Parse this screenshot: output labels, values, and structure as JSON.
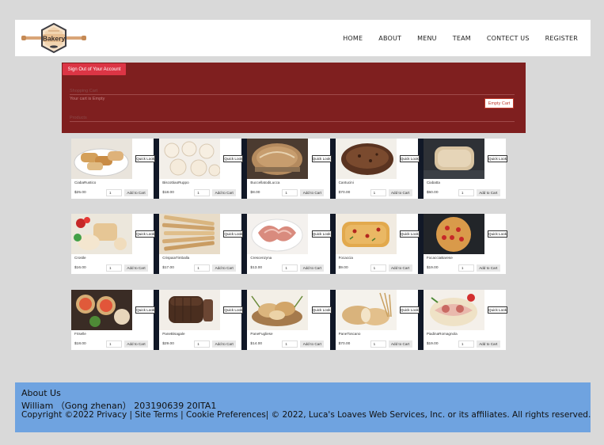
{
  "header": {
    "logo": {
      "text": "Bakery",
      "icon": "bakery-logo-rolling-pin"
    },
    "nav": [
      {
        "label": "HOME"
      },
      {
        "label": "ABOUT"
      },
      {
        "label": "MENU"
      },
      {
        "label": "TEAM"
      },
      {
        "label": "CONTECT US"
      },
      {
        "label": "REGISTER"
      }
    ]
  },
  "cart": {
    "signout_label": "Sign Out of Your Account",
    "title": "Shopping Cart",
    "empty_text": "Your cart is Empty",
    "empty_button": "Empty Cart",
    "products_label": "Products"
  },
  "products": [
    [
      {
        "name": "CiabaRustico",
        "price": "$25.00",
        "qty": "1",
        "quick_look": "Quick Look",
        "add_label": "Add to Cart",
        "image": "bread-loaves-cut"
      },
      {
        "name": "BiscottiaoRuppo",
        "price": "$18.00",
        "qty": "1",
        "quick_look": "Quick Look",
        "add_label": "Add to Cart",
        "image": "white-knot-buns"
      },
      {
        "name": "BuccellatodiLucca",
        "price": "$8.00",
        "qty": "1",
        "quick_look": "Quick Look",
        "add_label": "Add to Cart",
        "image": "round-rustic-loaf"
      },
      {
        "name": "Cantucini",
        "price": "$70.00",
        "qty": "1",
        "quick_look": "Quick Look",
        "add_label": "Add to Cart",
        "image": "dark-sliced-loaf"
      },
      {
        "name": "Ciabatta",
        "price": "$50.00",
        "qty": "1",
        "quick_look": "Quick Look",
        "add_label": "Add to Cart",
        "image": "ciabatta-on-slate"
      }
    ],
    [
      {
        "name": "Crostle",
        "price": "$16.00",
        "qty": "1",
        "quick_look": "Quick Look",
        "add_label": "Add to Cart",
        "image": "crostini-tomatoes"
      },
      {
        "name": "CrispaiaTimballa",
        "price": "$17.00",
        "qty": "1",
        "quick_look": "Quick Look",
        "add_label": "Add to Cart",
        "image": "breadsticks"
      },
      {
        "name": "Crescenzyna",
        "price": "$13.00",
        "qty": "1",
        "quick_look": "Quick Look",
        "add_label": "Add to Cart",
        "image": "ham-slices-plate"
      },
      {
        "name": "Focaccia",
        "price": "$9.00",
        "qty": "1",
        "quick_look": "Quick Look",
        "add_label": "Add to Cart",
        "image": "focaccia-herbs"
      },
      {
        "name": "FocacciaBarese",
        "price": "$19.00",
        "qty": "1",
        "quick_look": "Quick Look",
        "add_label": "Add to Cart",
        "image": "focaccia-tomato-dark"
      }
    ],
    [
      {
        "name": "Friselle",
        "price": "$18.00",
        "qty": "1",
        "quick_look": "Quick Look",
        "add_label": "Add to Cart",
        "image": "friselle-tomato"
      },
      {
        "name": "PaneBisagale",
        "price": "$29.00",
        "qty": "1",
        "quick_look": "Quick Look",
        "add_label": "Add to Cart",
        "image": "rye-loaf"
      },
      {
        "name": "PaneFugliese",
        "price": "$14.00",
        "qty": "1",
        "quick_look": "Quick Look",
        "add_label": "Add to Cart",
        "image": "bread-basket-board"
      },
      {
        "name": "PaneToscano",
        "price": "$70.00",
        "qty": "1",
        "quick_look": "Quick Look",
        "add_label": "Add to Cart",
        "image": "bread-with-wheat"
      },
      {
        "name": "PiadinaRomagnola",
        "price": "$19.00",
        "qty": "1",
        "quick_look": "Quick Look",
        "add_label": "Add to Cart",
        "image": "piadina-salami"
      }
    ]
  ],
  "footer": {
    "about": "About Us",
    "author": "William （Gong zhenan） 203190639 20ITA1",
    "copyright": "Copyright ©2022 Privacy | Site Terms | Cookie Preferences| © 2022, Luca's Loaves Web Services, Inc. or its affiliates. All rights reserved."
  },
  "colors": {
    "cart_panel": "#7f1f1f",
    "signout_button": "#dc3545",
    "footer": "#6fa3e0",
    "page_background": "#d9d9d9"
  }
}
